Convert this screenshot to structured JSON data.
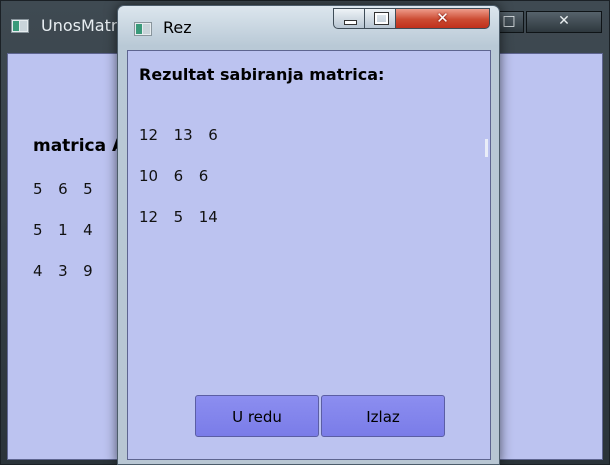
{
  "background_window": {
    "title": "UnosMatrica",
    "close_glyph": "✕",
    "max_glyph": "□",
    "matrix_label": "matrica A",
    "rows": [
      "5  6  5",
      "5  1  4",
      "4  3  9"
    ]
  },
  "dialog": {
    "title": "Rez",
    "heading": "Rezultat sabiranja matrica:",
    "rows": [
      "12  13  6",
      "10  6  6",
      "12  5  14"
    ],
    "ok_label": "U redu",
    "exit_label": "Izlaz",
    "close_glyph": "✕"
  },
  "icons": {
    "app_icon": "app-window-icon",
    "minimize": "minimize-icon",
    "maximize": "maximize-icon",
    "close": "close-icon"
  },
  "colors": {
    "client_background": "#bcc3f0",
    "button_fill": "#7a7ce8",
    "close_button": "#c0301c"
  }
}
